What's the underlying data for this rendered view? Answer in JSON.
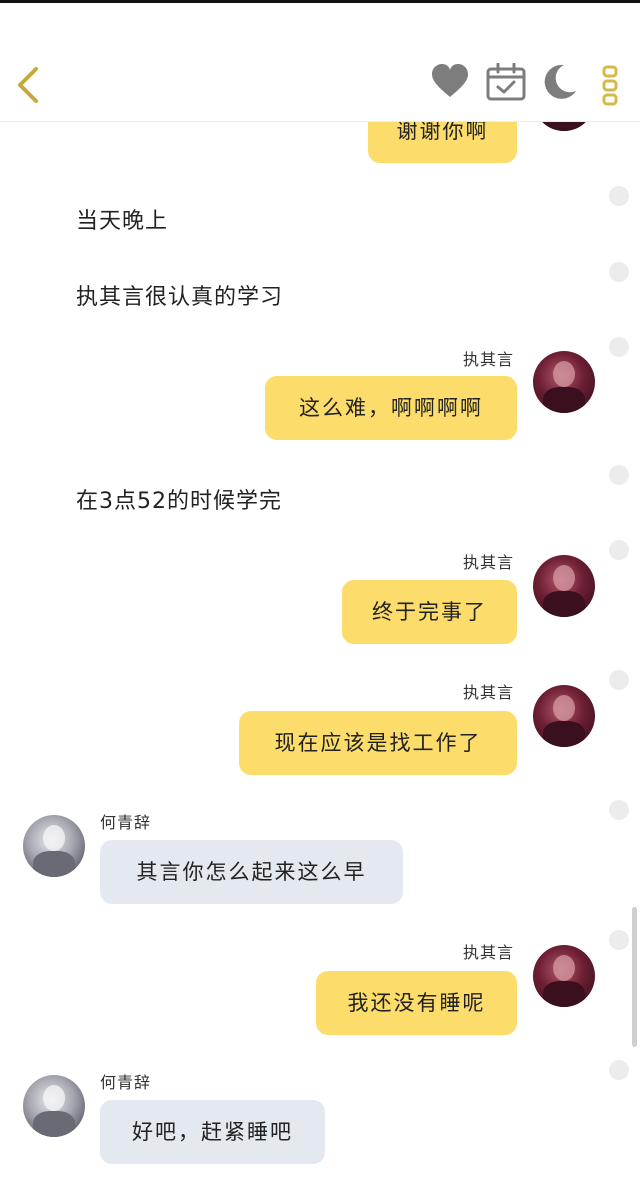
{
  "header": {
    "icons": [
      "back-icon",
      "heart-icon",
      "calendar-icon",
      "moon-icon",
      "more-icon"
    ]
  },
  "messages": {
    "m0": {
      "text": "谢谢你啊"
    },
    "n1": {
      "text": "当天晚上"
    },
    "n2": {
      "text": "执其言很认真的学习"
    },
    "m3": {
      "sender": "执其言",
      "text": "这么难，啊啊啊啊"
    },
    "n4": {
      "text": "在3点52的时候学完"
    },
    "m5": {
      "sender": "执其言",
      "text": "终于完事了"
    },
    "m6": {
      "sender": "执其言",
      "text": "现在应该是找工作了"
    },
    "m7": {
      "sender": "何青辞",
      "text": "其言你怎么起来这么早"
    },
    "m8": {
      "sender": "执其言",
      "text": "我还没有睡呢"
    },
    "m9": {
      "sender": "何青辞",
      "text": "好吧，赶紧睡吧"
    }
  },
  "colors": {
    "right_bubble": "#fcdc6a",
    "left_bubble": "#e4e8ef",
    "icon_gray": "#7d7d7d",
    "more_dots": "#d4b94a",
    "back_arrow": "#c8a83a"
  }
}
